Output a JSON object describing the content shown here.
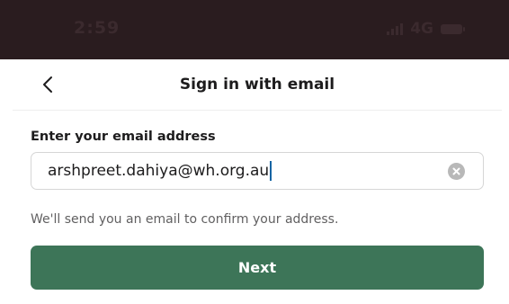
{
  "status_bar": {
    "time": "2:59",
    "network": "4G"
  },
  "nav": {
    "title": "Sign in with email",
    "back_icon": "chevron-left-icon"
  },
  "form": {
    "label": "Enter your email address",
    "email_value": "arshpreet.dahiya@wh.org.au",
    "clear_icon": "clear-icon",
    "helper_text": "We'll send you an email to confirm your address."
  },
  "actions": {
    "next_label": "Next"
  },
  "colors": {
    "primary_button": "#3d7558",
    "status_bar_bg": "#2a1c1f"
  }
}
